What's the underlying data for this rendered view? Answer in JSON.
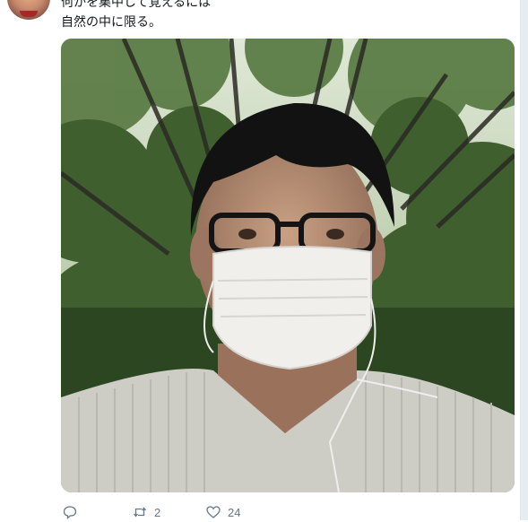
{
  "tweet": {
    "text_lines": [
      "何かを集中して覚えるには",
      "自然の中に限る。"
    ]
  },
  "actions": {
    "reply": {
      "icon": "reply-icon",
      "count": ""
    },
    "retweet": {
      "icon": "retweet-icon",
      "count": "2"
    },
    "like": {
      "icon": "heart-icon",
      "count": "24"
    }
  },
  "colors": {
    "text": "#14171a",
    "muted": "#657786",
    "border": "#e1e8ed"
  }
}
